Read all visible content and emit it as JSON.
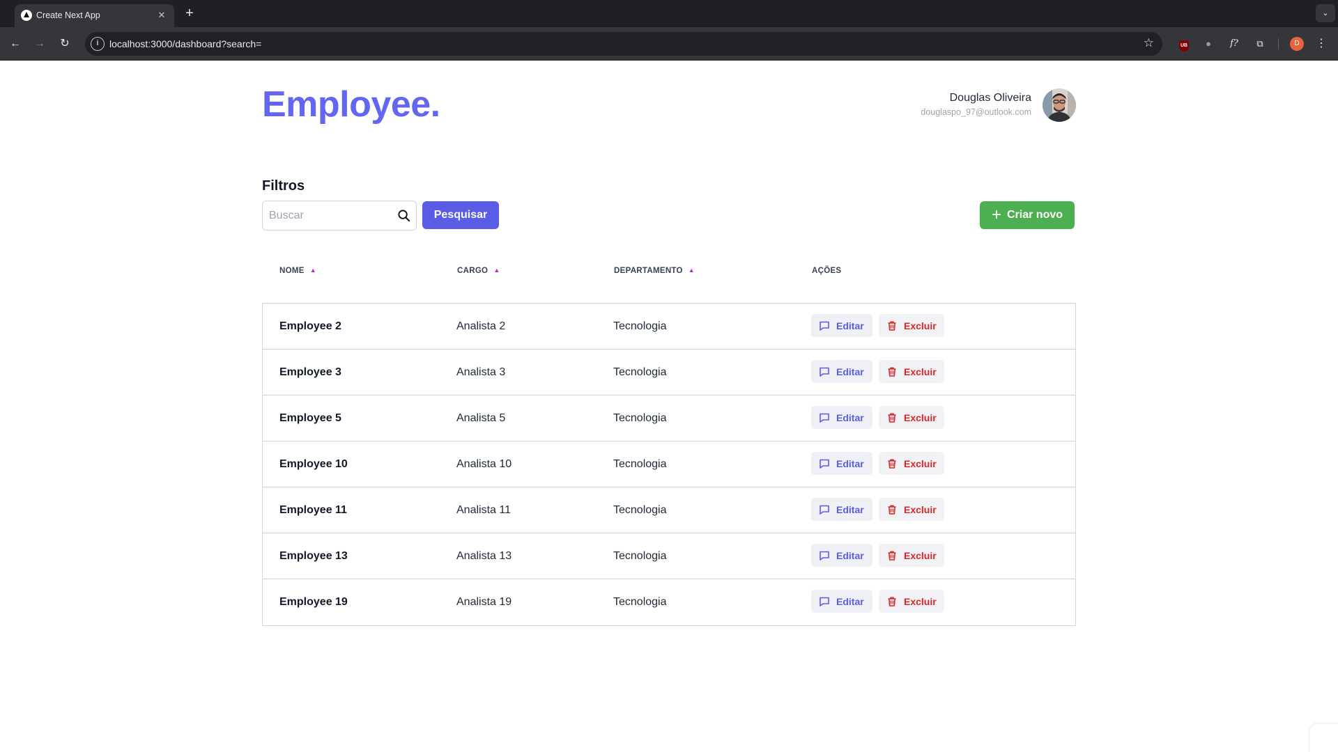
{
  "browser": {
    "tab_title": "Create Next App",
    "tab_close": "✕",
    "new_tab": "+",
    "tab_menu": "⌄",
    "url_host": "localhost",
    "url_rest": ":3000/dashboard?search=",
    "profile_initial": "D",
    "ext_ub": "UB",
    "ext_fx": "f?"
  },
  "header": {
    "brand": "Employee.",
    "user_name": "Douglas Oliveira",
    "user_email": "douglaspo_97@outlook.com"
  },
  "filters": {
    "title": "Filtros",
    "search_placeholder": "Buscar",
    "search_value": "",
    "search_button": "Pesquisar",
    "create_button": "Criar novo"
  },
  "table": {
    "headers": {
      "nome": "NOME",
      "cargo": "CARGO",
      "departamento": "DEPARTAMENTO",
      "acoes": "AÇÕES"
    },
    "edit_label": "Editar",
    "delete_label": "Excluir",
    "rows": [
      {
        "nome": "Employee 2",
        "cargo": "Analista 2",
        "departamento": "Tecnologia"
      },
      {
        "nome": "Employee 3",
        "cargo": "Analista 3",
        "departamento": "Tecnologia"
      },
      {
        "nome": "Employee 5",
        "cargo": "Analista 5",
        "departamento": "Tecnologia"
      },
      {
        "nome": "Employee 10",
        "cargo": "Analista 10",
        "departamento": "Tecnologia"
      },
      {
        "nome": "Employee 11",
        "cargo": "Analista 11",
        "departamento": "Tecnologia"
      },
      {
        "nome": "Employee 13",
        "cargo": "Analista 13",
        "departamento": "Tecnologia"
      },
      {
        "nome": "Employee 19",
        "cargo": "Analista 19",
        "departamento": "Tecnologia"
      }
    ]
  },
  "colors": {
    "brand": "#6366f1",
    "primary_button": "#5b5ce6",
    "create_button": "#4caf50",
    "delete_text": "#dc2626",
    "sort_icon": "#c026d3"
  },
  "icons": {
    "search": "search-icon",
    "plus": "plus-icon",
    "sort": "chevron-up-icon",
    "edit": "message-square-icon",
    "delete": "trash-icon"
  }
}
